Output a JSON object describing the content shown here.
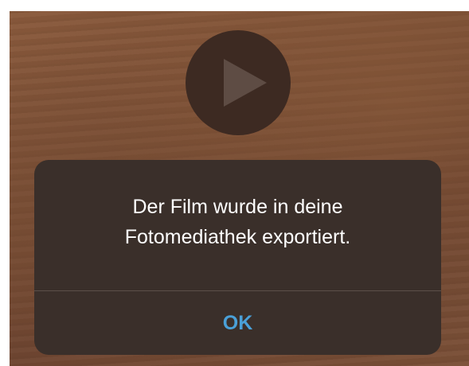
{
  "video": {
    "play_icon": "play-icon"
  },
  "alert": {
    "message_line_1": "Der Film wurde in deine",
    "message_line_2": "Fotomediathek exportiert.",
    "ok_label": "OK"
  },
  "colors": {
    "alert_background": "#3a2f2a",
    "alert_text": "#ffffff",
    "action_accent": "#4aa0d8",
    "play_button_background": "#3d2a22",
    "play_glyph": "#5e4c44"
  }
}
